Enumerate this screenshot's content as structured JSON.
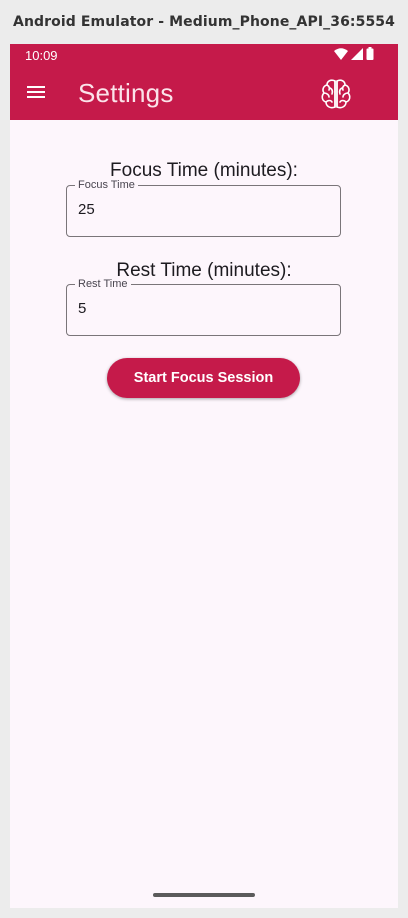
{
  "window": {
    "title": "Android Emulator - Medium_Phone_API_36:5554"
  },
  "status_bar": {
    "time": "10:09",
    "icons": [
      "wifi-icon",
      "cell-signal-icon",
      "battery-icon"
    ]
  },
  "app_bar": {
    "title": "Settings",
    "menu_icon": "menu-icon",
    "action_icon": "brain-icon"
  },
  "focus": {
    "heading": "Focus Time (minutes):",
    "label": "Focus Time",
    "value": "25"
  },
  "rest": {
    "heading": "Rest Time (minutes):",
    "label": "Rest Time",
    "value": "5"
  },
  "start_button": {
    "label": "Start Focus Session"
  },
  "colors": {
    "primary": "#c51a4a",
    "background": "#fdf6fc",
    "on_primary": "#ffffff"
  }
}
